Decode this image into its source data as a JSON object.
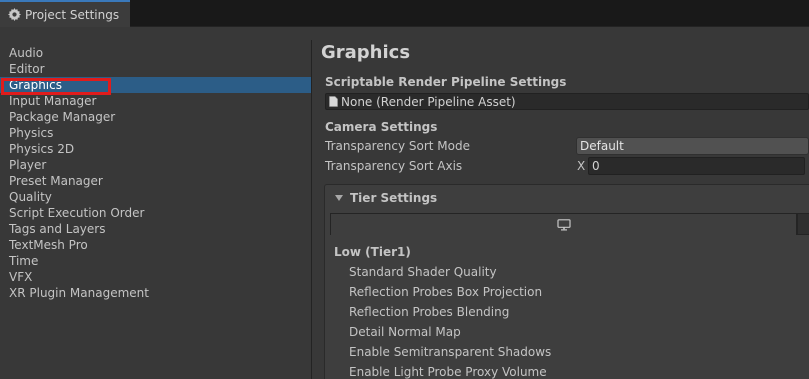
{
  "window": {
    "tab_title": "Project Settings",
    "tab_icon": "gear-icon"
  },
  "sidebar": {
    "items": [
      {
        "label": "Audio"
      },
      {
        "label": "Editor"
      },
      {
        "label": "Graphics",
        "selected": true
      },
      {
        "label": "Input Manager"
      },
      {
        "label": "Package Manager"
      },
      {
        "label": "Physics"
      },
      {
        "label": "Physics 2D"
      },
      {
        "label": "Player"
      },
      {
        "label": "Preset Manager"
      },
      {
        "label": "Quality"
      },
      {
        "label": "Script Execution Order"
      },
      {
        "label": "Tags and Layers"
      },
      {
        "label": "TextMesh Pro"
      },
      {
        "label": "Time"
      },
      {
        "label": "VFX"
      },
      {
        "label": "XR Plugin Management"
      }
    ]
  },
  "main": {
    "title": "Graphics",
    "srp": {
      "heading": "Scriptable Render Pipeline Settings",
      "value": "None (Render Pipeline Asset)"
    },
    "camera": {
      "heading": "Camera Settings",
      "sort_mode_label": "Transparency Sort Mode",
      "sort_mode_value": "Default",
      "sort_axis_label": "Transparency Sort Axis",
      "sort_axis_component": "X",
      "sort_axis_value": "0"
    },
    "tier": {
      "heading": "Tier Settings",
      "platform_icon": "monitor-icon",
      "tier_name": "Low (Tier1)",
      "rows": [
        "Standard Shader Quality",
        "Reflection Probes Box Projection",
        "Reflection Probes Blending",
        "Detail Normal Map",
        "Enable Semitransparent Shadows",
        "Enable Light Probe Proxy Volume"
      ]
    }
  },
  "colors": {
    "selection": "#2c5d87",
    "highlight_outline": "#e01c1c",
    "background": "#383838"
  }
}
